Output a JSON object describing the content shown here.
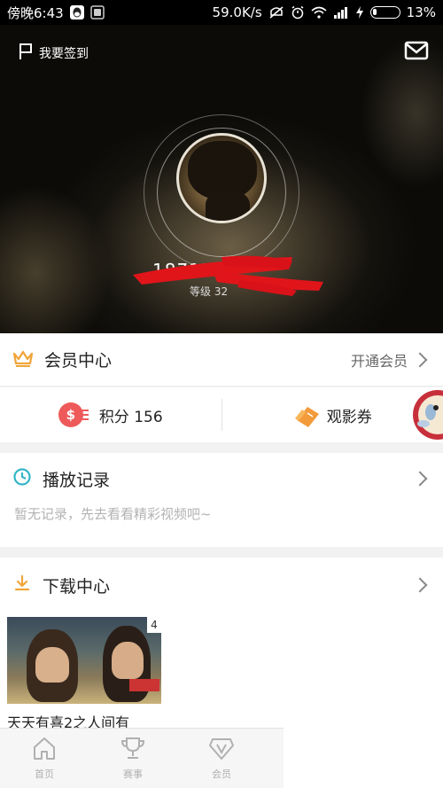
{
  "status_bar": {
    "time": "傍晚6:43",
    "speed": "59.0K/s",
    "battery": "13%",
    "battery_level": 0.13
  },
  "header": {
    "checkin_label": "我要签到",
    "user_id": "1871500",
    "level": "等级 32"
  },
  "member_center": {
    "title": "会员中心",
    "action": "开通会员"
  },
  "points": {
    "coin_symbol": "$",
    "label": "积分 156",
    "ticket_label": "观影券"
  },
  "history": {
    "title": "播放记录",
    "empty_text": "暂无记录，先去看看精彩视频吧~"
  },
  "downloads": {
    "title": "下载中心",
    "items": [
      {
        "title": "天天有喜2之人间有",
        "count": "4"
      }
    ]
  },
  "bottom_nav": {
    "items": [
      {
        "label": "首页",
        "icon": "home-icon"
      },
      {
        "label": "赛事",
        "icon": "trophy-icon"
      },
      {
        "label": "会员",
        "icon": "vip-diamond-icon"
      }
    ]
  },
  "colors": {
    "accent_orange": "#f0a53a",
    "history_teal": "#33b5c8",
    "coin_red": "#ee5a5a",
    "ticket_orange": "#f39a3a"
  }
}
